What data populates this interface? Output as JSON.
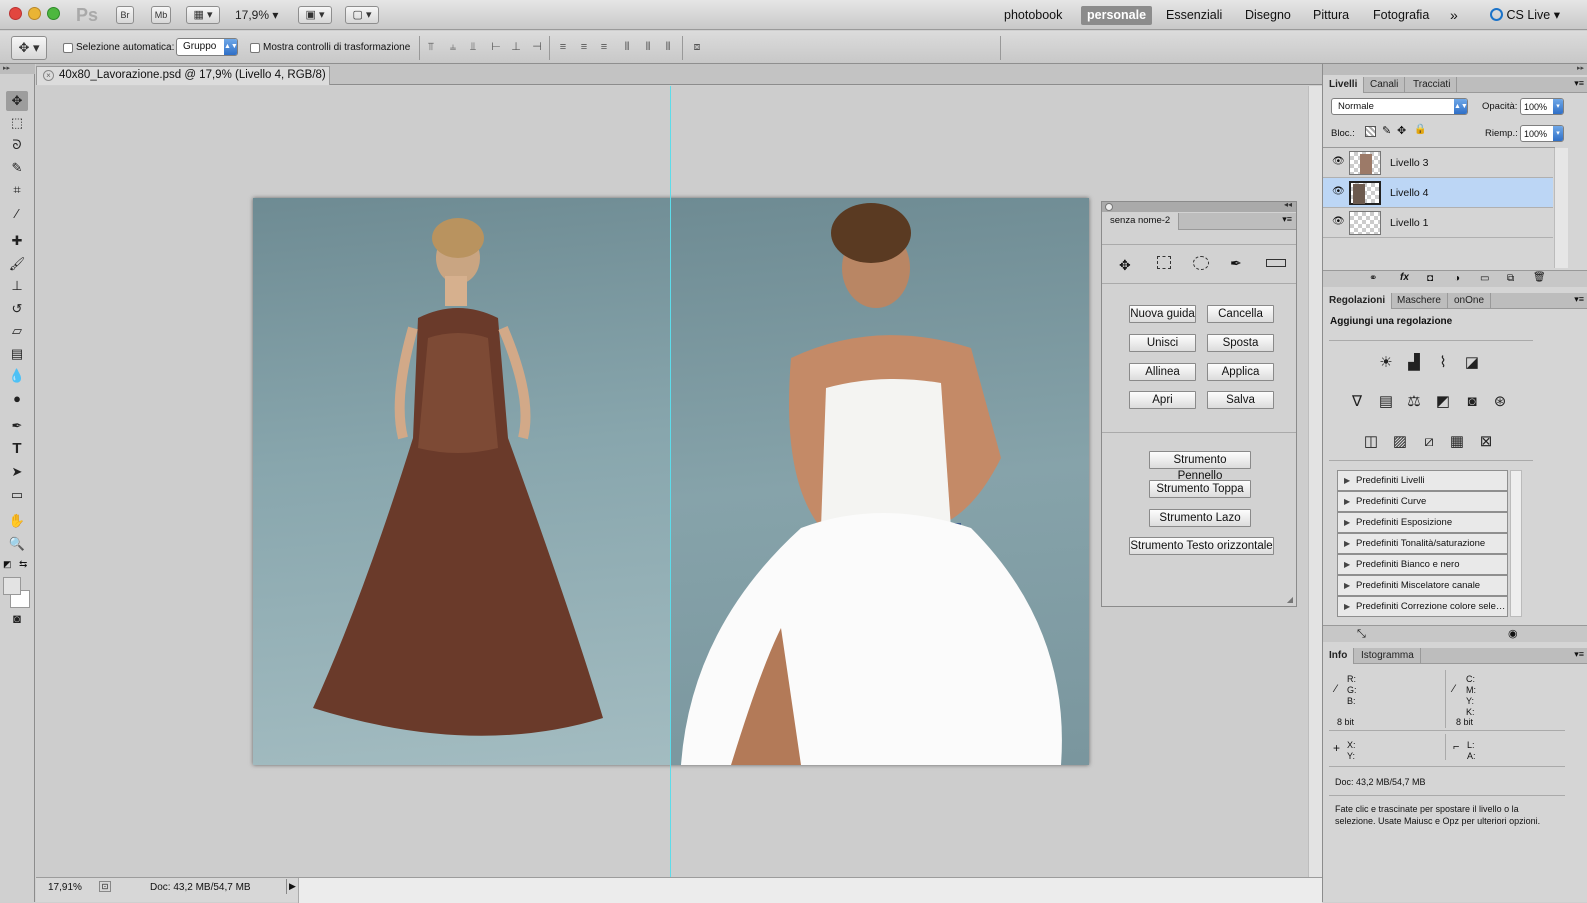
{
  "menubar": {
    "app_logo": "Ps",
    "bridge_btn": "Br",
    "minibridge_btn": "Mb",
    "zoom": "17,9%",
    "workspaces": [
      "photobook",
      "personale",
      "Essenziali",
      "Disegno",
      "Pittura",
      "Fotografia"
    ],
    "active_workspace": "personale",
    "more": "»",
    "cslive": "CS Live"
  },
  "options": {
    "auto_select_label": "Selezione automatica:",
    "auto_select_value": "Gruppo",
    "transform_label": "Mostra controlli di trasformazione"
  },
  "document": {
    "tab_title": "40x80_Lavorazione.psd @ 17,9% (Livello 4, RGB/8) *"
  },
  "floating_panel": {
    "tab": "senza nome-2",
    "buttons_left": [
      "Nuova guida",
      "Unisci",
      "Allinea",
      "Apri"
    ],
    "buttons_right": [
      "Cancella",
      "Sposta",
      "Applica",
      "Salva"
    ],
    "tool_buttons": [
      "Strumento Pennello",
      "Strumento Toppa",
      "Strumento Lazo",
      "Strumento Testo orizzontale"
    ]
  },
  "layers_panel": {
    "tabs": [
      "Livelli",
      "Canali",
      "Tracciati"
    ],
    "blend_mode": "Normale",
    "opacity_label": "Opacità:",
    "opacity_value": "100%",
    "lock_label": "Bloc.:",
    "fill_label": "Riemp.:",
    "fill_value": "100%",
    "layers": [
      "Livello 3",
      "Livello 4",
      "Livello 1"
    ],
    "selected_layer": "Livello 4"
  },
  "adjustments_panel": {
    "tabs": [
      "Regolazioni",
      "Maschere",
      "onOne"
    ],
    "title": "Aggiungi una regolazione",
    "presets": [
      "Predefiniti Livelli",
      "Predefiniti Curve",
      "Predefiniti Esposizione",
      "Predefiniti Tonalità/saturazione",
      "Predefiniti Bianco e nero",
      "Predefiniti Miscelatore canale",
      "Predefiniti Correzione colore sele…"
    ]
  },
  "info_panel": {
    "tabs": [
      "Info",
      "Istogramma"
    ],
    "rgb": [
      "R:",
      "G:",
      "B:"
    ],
    "cmyk": [
      "C:",
      "M:",
      "Y:",
      "K:"
    ],
    "bits_left": "8 bit",
    "bits_right": "8 bit",
    "xy": [
      "X:",
      "Y:"
    ],
    "la": [
      "L:",
      "A:"
    ],
    "doc": "Doc: 43,2 MB/54,7 MB",
    "hint": "Fate clic e trascinate per spostare il livello o la selezione. Usate Maiusc e Opz per ulteriori opzioni."
  },
  "status": {
    "zoom": "17,91%",
    "doc": "Doc: 43,2 MB/54,7 MB"
  }
}
